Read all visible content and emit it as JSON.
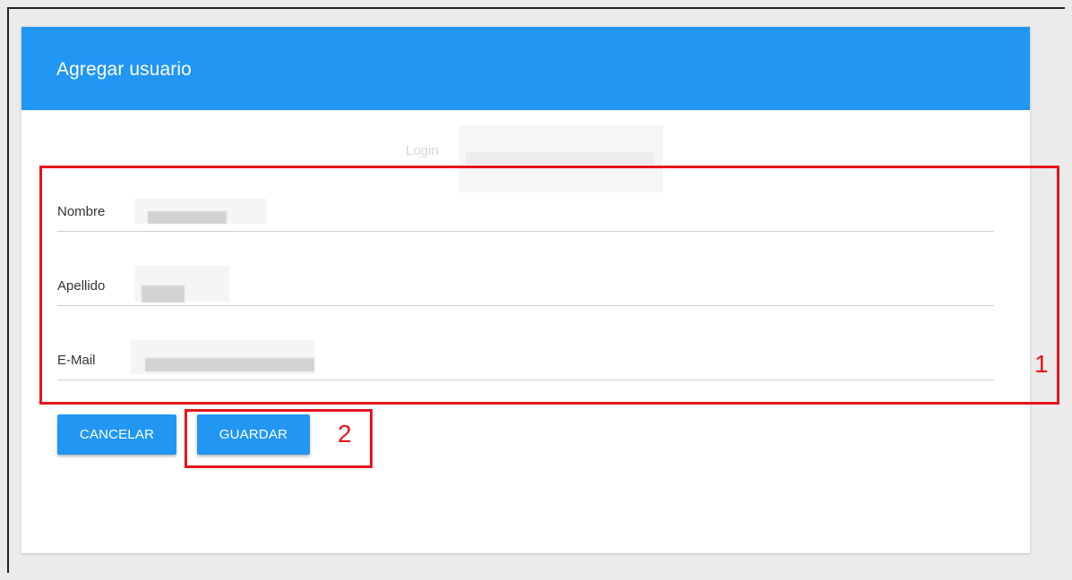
{
  "dialog": {
    "title": "Agregar usuario"
  },
  "login": {
    "label": "Login"
  },
  "fields": [
    {
      "label": "Nombre"
    },
    {
      "label": "Apellido"
    },
    {
      "label": "E-Mail"
    }
  ],
  "buttons": {
    "cancel_label": "CANCELAR",
    "save_label": "GUARDAR"
  },
  "annotations": {
    "fields_marker": "1",
    "save_marker": "2"
  },
  "colors": {
    "header": "#2196f3",
    "button": "#2196f3",
    "annotation": "#e8141c",
    "background": "#ebebeb"
  }
}
